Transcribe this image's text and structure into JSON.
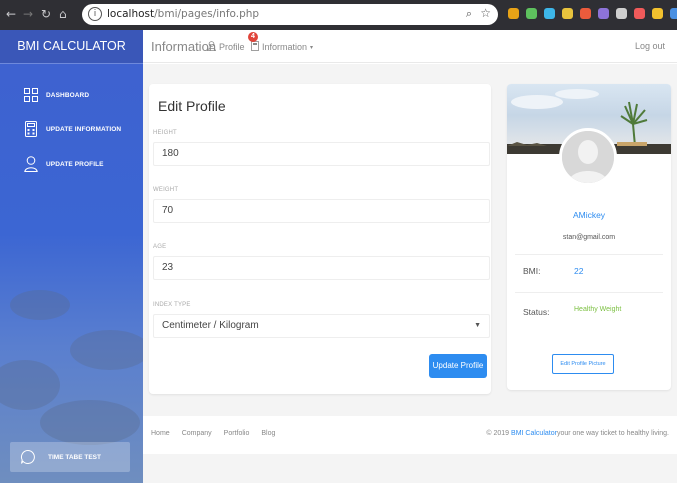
{
  "browser": {
    "url_host": "localhost",
    "url_path": "/bmi/pages/info.php",
    "nav_icons": [
      "back-icon",
      "forward-icon",
      "reload-icon",
      "home-icon"
    ],
    "extension_colors": [
      "#e8a317",
      "#5ec15e",
      "#3db6e8",
      "#e8c33d",
      "#ec5b3c",
      "#8d73d8",
      "#cfcfcf",
      "#f05a5a",
      "#f2c12e",
      "#4a90e2"
    ]
  },
  "sidebar": {
    "brand": "BMI CALCULATOR",
    "items": [
      {
        "label": "DASHBOARD",
        "icon": "grid-icon"
      },
      {
        "label": "UPDATE INFORMATION",
        "icon": "calculator-icon"
      },
      {
        "label": "UPDATE PROFILE",
        "icon": "user-icon"
      }
    ],
    "bottom": {
      "label": "TIME TABE TEST",
      "icon": "chat-icon"
    }
  },
  "topbar": {
    "title": "Information",
    "profile_link": "Profile",
    "info_link": "Information",
    "notification_count": "4",
    "logout": "Log out"
  },
  "edit_profile": {
    "title": "Edit Profile",
    "height_label": "HEIGHT",
    "height_value": "180",
    "weight_label": "WEIGHT",
    "weight_value": "70",
    "age_label": "AGE",
    "age_value": "23",
    "index_label": "INDEX TYPE",
    "index_value": "Centimeter / Kilogram",
    "submit": "Update Profile"
  },
  "profile_card": {
    "name": "AMickey",
    "email": "stan@gmail.com",
    "bmi_label": "BMI:",
    "bmi_value": "22",
    "status_label": "Status:",
    "status_value": "Healthy Weight",
    "edit_picture": "Edit Profile Picture"
  },
  "footer": {
    "links": [
      "Home",
      "Company",
      "Portfolio",
      "Blog"
    ],
    "copyright_prefix": "© 2019",
    "copyright_link": "BMI Calculator",
    "copyright_suffix": "your one way ticket to healthy living."
  },
  "colors": {
    "accent": "#2d8cf0",
    "status_green": "#7cc042",
    "sidebar_blue": "#3e61cf"
  }
}
